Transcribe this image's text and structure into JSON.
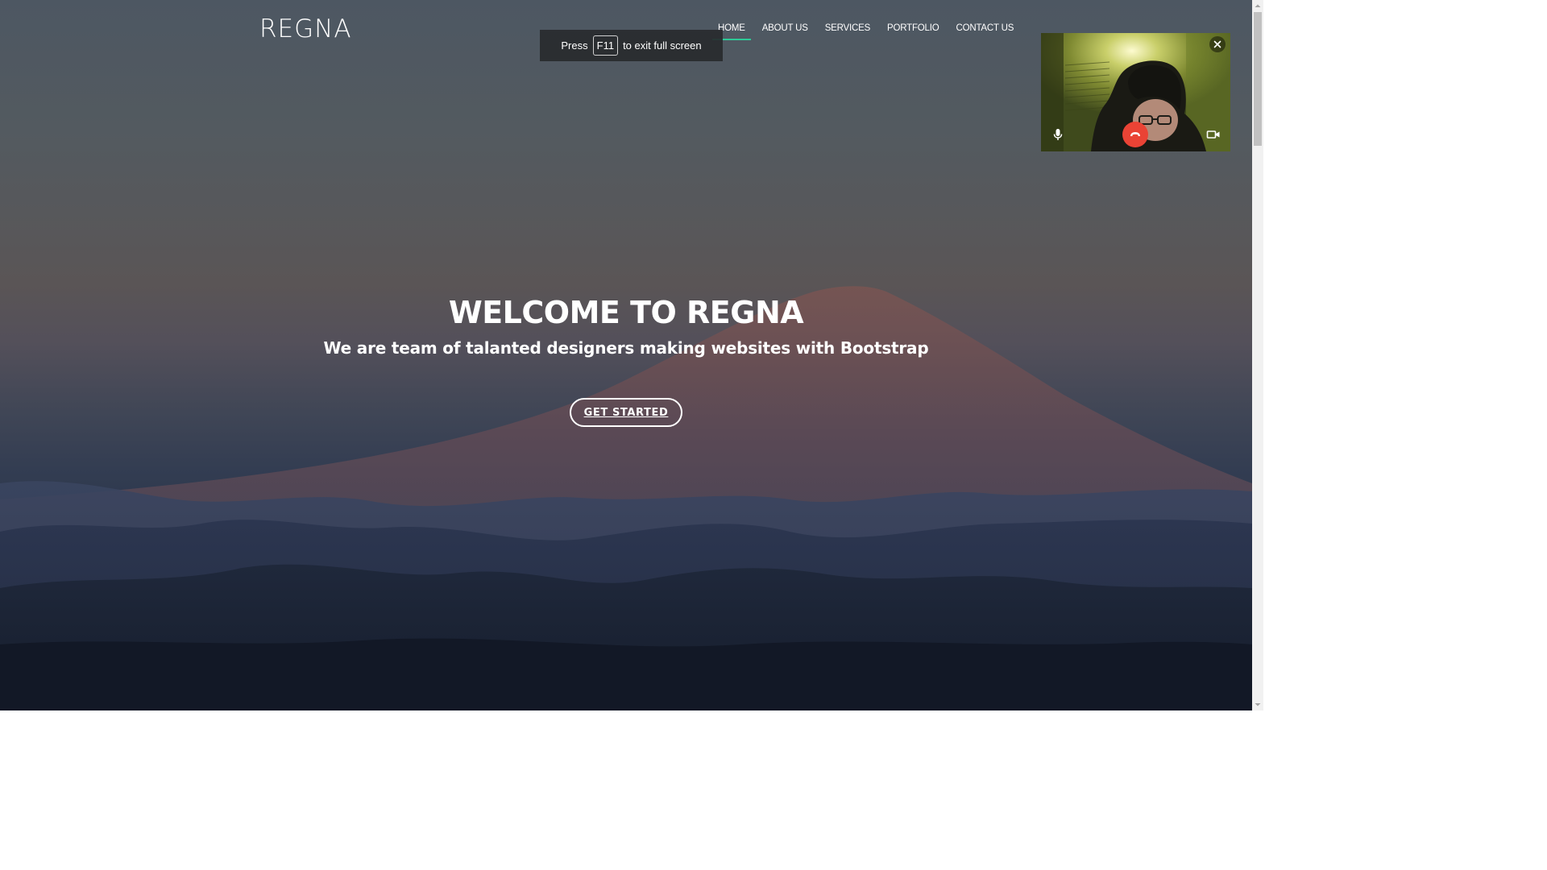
{
  "site": {
    "logo": "REGNA"
  },
  "nav": {
    "items": [
      {
        "label": "HOME",
        "active": true
      },
      {
        "label": "ABOUT US",
        "active": false
      },
      {
        "label": "SERVICES",
        "active": false
      },
      {
        "label": "PORTFOLIO",
        "active": false
      },
      {
        "label": "CONTACT US",
        "active": false
      }
    ]
  },
  "fullscreen_toast": {
    "prefix": "Press",
    "key": "F11",
    "suffix": "to exit full screen"
  },
  "hero": {
    "title": "WELCOME TO REGNA",
    "subtitle": "We are team of talanted designers making websites with Bootstrap",
    "cta_label": "GET STARTED"
  },
  "video_call": {
    "icons": [
      "close-icon",
      "microphone-icon",
      "hang-up-icon",
      "video-camera-icon"
    ]
  },
  "colors": {
    "accent": "#2dc997",
    "hangup": "#ea4335",
    "text": "#ffffff"
  }
}
